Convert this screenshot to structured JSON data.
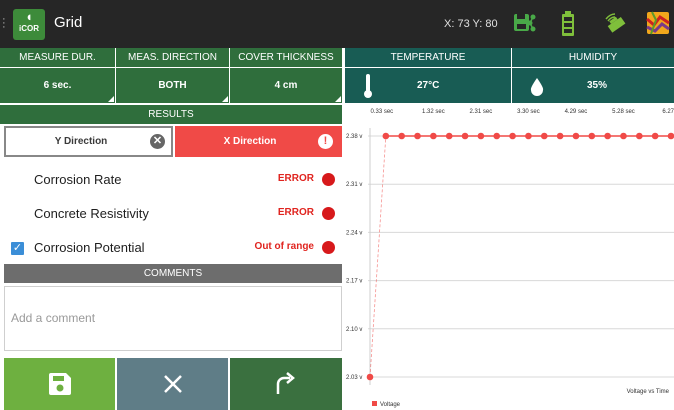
{
  "topbar": {
    "logo_text": "iCOR",
    "title": "Grid",
    "coords": "X: 73 Y: 80",
    "icons": [
      "save-share-icon",
      "battery-icon",
      "signal-icon",
      "map-icon"
    ]
  },
  "settings": {
    "measure_dur": {
      "label": "MEASURE DUR.",
      "value": "6 sec."
    },
    "meas_direction": {
      "label": "MEAS. DIRECTION",
      "value": "BOTH"
    },
    "cover_thickness": {
      "label": "COVER THICKNESS",
      "value": "4 cm"
    }
  },
  "environment": {
    "temperature": {
      "label": "TEMPERATURE",
      "value": "27°C"
    },
    "humidity": {
      "label": "HUMIDITY",
      "value": "35%"
    }
  },
  "results": {
    "header": "RESULTS",
    "tab_y": "Y Direction",
    "tab_x": "X Direction",
    "rows": [
      {
        "name": "Corrosion Rate",
        "status": "ERROR",
        "checked": false
      },
      {
        "name": "Concrete Resistivity",
        "status": "ERROR",
        "checked": false
      },
      {
        "name": "Corrosion Potential",
        "status": "Out of range",
        "checked": true
      }
    ]
  },
  "comments": {
    "header": "COMMENTS",
    "placeholder": "Add a comment"
  },
  "actions": [
    "save-button",
    "cancel-button",
    "redo-button"
  ],
  "colors": {
    "primary_green": "#2f6e3c",
    "teal": "#185c54",
    "error_red": "#f04a47",
    "dot_red": "#d7191b"
  },
  "chart_data": {
    "type": "line",
    "x_tick_labels": [
      "0.33 sec",
      "1.32 sec",
      "2.31 sec",
      "3.30 sec",
      "4.29 sec",
      "5.28 sec",
      "6.27"
    ],
    "y_tick_labels": [
      "2.38 v",
      "2.31 v",
      "2.24 v",
      "2.17 v",
      "2.10 v",
      "2.03 v"
    ],
    "ylim": [
      2.03,
      2.38
    ],
    "annotation": "Voltage vs Time",
    "series": [
      {
        "name": "Voltage",
        "color": "#f04a47",
        "x": [
          0.0,
          0.33,
          0.66,
          0.99,
          1.32,
          1.65,
          1.98,
          2.31,
          2.64,
          2.97,
          3.3,
          3.63,
          3.96,
          4.29,
          4.62,
          4.95,
          5.28,
          5.61,
          5.94,
          6.27
        ],
        "y": [
          2.03,
          2.38,
          2.38,
          2.38,
          2.38,
          2.38,
          2.38,
          2.38,
          2.38,
          2.38,
          2.38,
          2.38,
          2.38,
          2.38,
          2.38,
          2.38,
          2.38,
          2.38,
          2.38,
          2.38
        ]
      }
    ]
  }
}
